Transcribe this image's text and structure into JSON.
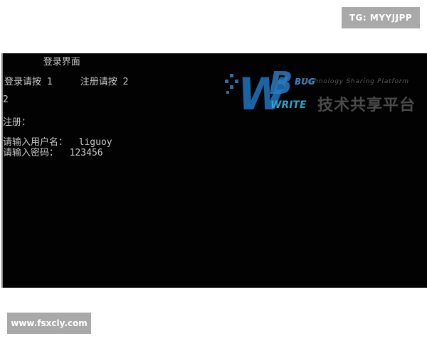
{
  "overlay": {
    "top_tag": "TG: MYYJJPP",
    "bottom_tag": "www.fsxcly.com"
  },
  "console": {
    "lines": [
      "       登录界面",
      "登录请按 1     注册请按 2",
      "2",
      "注册：",
      "请输入用户名：  liguoy",
      "请输入密码：  123456"
    ]
  },
  "watermark": {
    "brand_w": "W",
    "brand_b": "B",
    "brand_bug": "BUG",
    "brand_write": "WRITE",
    "tagline": "Technology Sharing Platform",
    "cn_name": "技术共享平台"
  },
  "colors": {
    "console_bg": "#020202",
    "console_text": "#c9c9c9",
    "tag_bg": "#a9a9a9",
    "watermark_blue": "#2fa3c9"
  }
}
